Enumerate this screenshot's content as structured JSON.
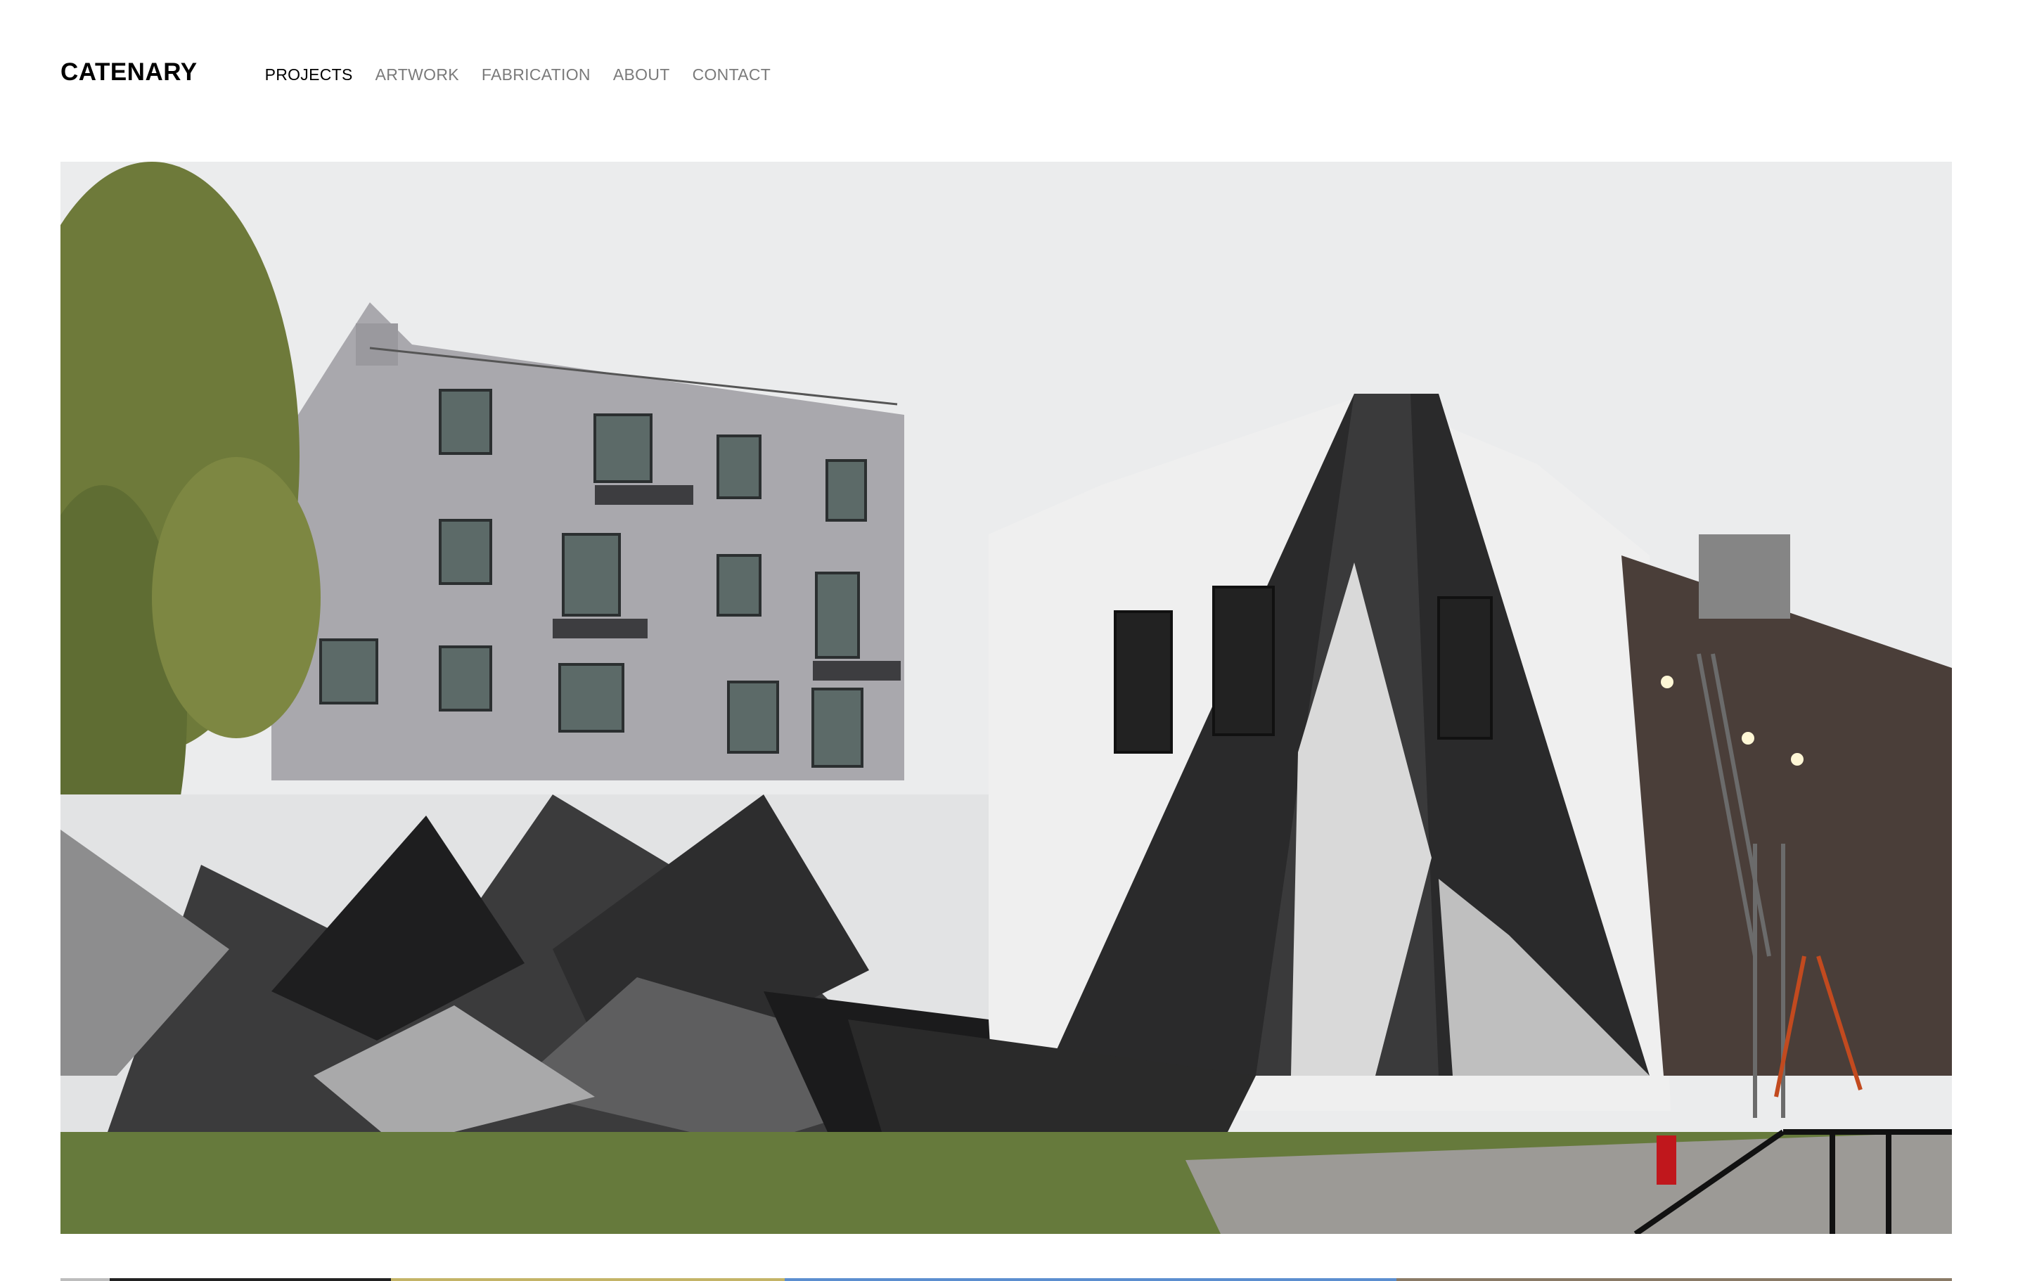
{
  "header": {
    "brand": "CATENARY",
    "nav": [
      {
        "label": "PROJECTS",
        "active": true
      },
      {
        "label": "ARTWORK",
        "active": false
      },
      {
        "label": "FABRICATION",
        "active": false
      },
      {
        "label": "ABOUT",
        "active": false
      },
      {
        "label": "CONTACT",
        "active": false
      }
    ]
  },
  "hero": {
    "image": "geometric-mural-photo"
  },
  "colors": {
    "text_active": "#000000",
    "text_nav": "#7a7a7a",
    "background": "#ffffff"
  }
}
